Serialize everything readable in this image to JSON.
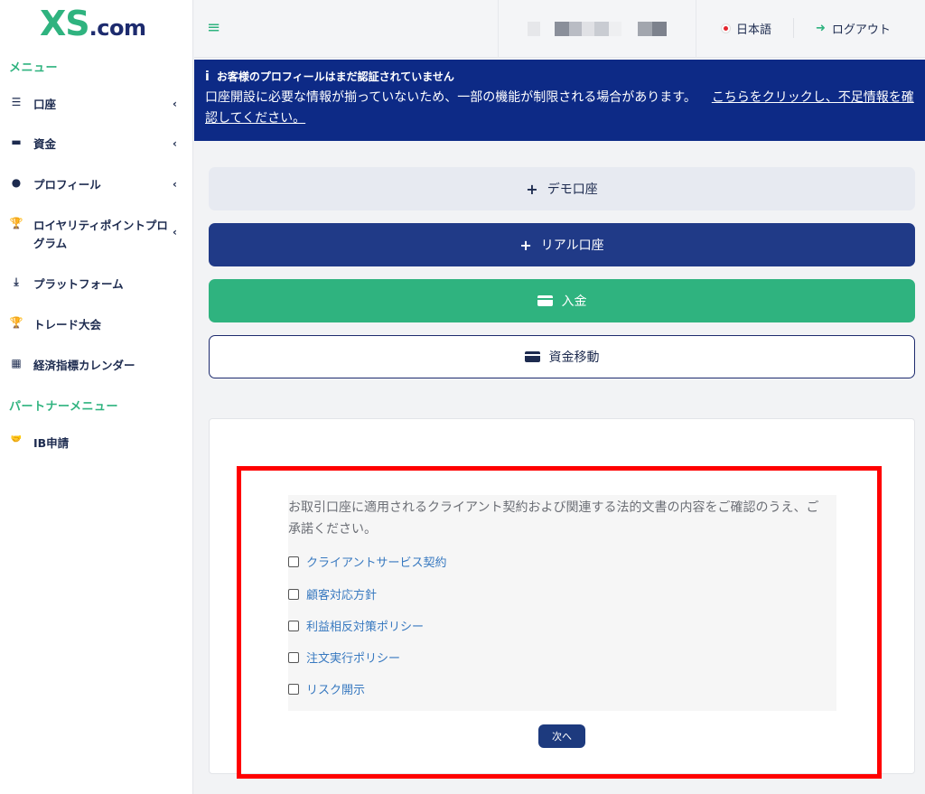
{
  "brand": {
    "logo_main": "XS",
    "logo_suffix": ".com"
  },
  "sidebar": {
    "menu_heading": "メニュー",
    "items": [
      {
        "label": "口座",
        "icon": "list-icon",
        "glyph": "☰",
        "has_chevron": true
      },
      {
        "label": "資金",
        "icon": "wallet-icon",
        "glyph": "▬",
        "has_chevron": true
      },
      {
        "label": "プロフィール",
        "icon": "user-icon",
        "glyph": "●",
        "has_chevron": true
      },
      {
        "label": "ロイヤリティポイントプログラム",
        "icon": "trophy-icon",
        "glyph": "🏆",
        "has_chevron": true
      },
      {
        "label": "プラットフォーム",
        "icon": "download-icon",
        "glyph": "⤓",
        "has_chevron": false
      },
      {
        "label": "トレード大会",
        "icon": "trophy-icon",
        "glyph": "🏆",
        "has_chevron": false
      },
      {
        "label": "経済指標カレンダー",
        "icon": "calendar-icon",
        "glyph": "▦",
        "has_chevron": false
      }
    ],
    "partner_heading": "パートナーメニュー",
    "partner_items": [
      {
        "label": "IB申請",
        "icon": "handshake-icon",
        "glyph": "🤝"
      }
    ],
    "chevron_glyph": "‹"
  },
  "topbar": {
    "menu_glyph": "≡",
    "language": "日本語",
    "logout": "ログアウト",
    "logout_glyph": "➜"
  },
  "banner": {
    "info_glyph": "i",
    "title": "お客様のプロフィールはまだ認証されていません",
    "message": "口座開設に必要な情報が揃っていないため、一部の機能が制限される場合があります。",
    "link": "こちらをクリックし、不足情報を確認してください。"
  },
  "actions": {
    "plus_glyph": "+",
    "demo": "デモ口座",
    "real": "リアル口座",
    "deposit": "入金",
    "transfer": "資金移動"
  },
  "agreement": {
    "intro": "お取引口座に適用されるクライアント契約および関連する法的文書の内容をご確認のうえ、ご承諾ください。",
    "documents": [
      {
        "label": "クライアントサービス契約",
        "checked": false
      },
      {
        "label": "顧客対応方針",
        "checked": false
      },
      {
        "label": "利益相反対策ポリシー",
        "checked": false
      },
      {
        "label": "注文実行ポリシー",
        "checked": false
      },
      {
        "label": "リスク開示",
        "checked": false
      }
    ],
    "next": "次へ"
  },
  "colors": {
    "brand_green": "#2fb37f",
    "navy": "#203a87",
    "banner_blue": "#0d2a86",
    "highlight_red": "#ff0000"
  }
}
